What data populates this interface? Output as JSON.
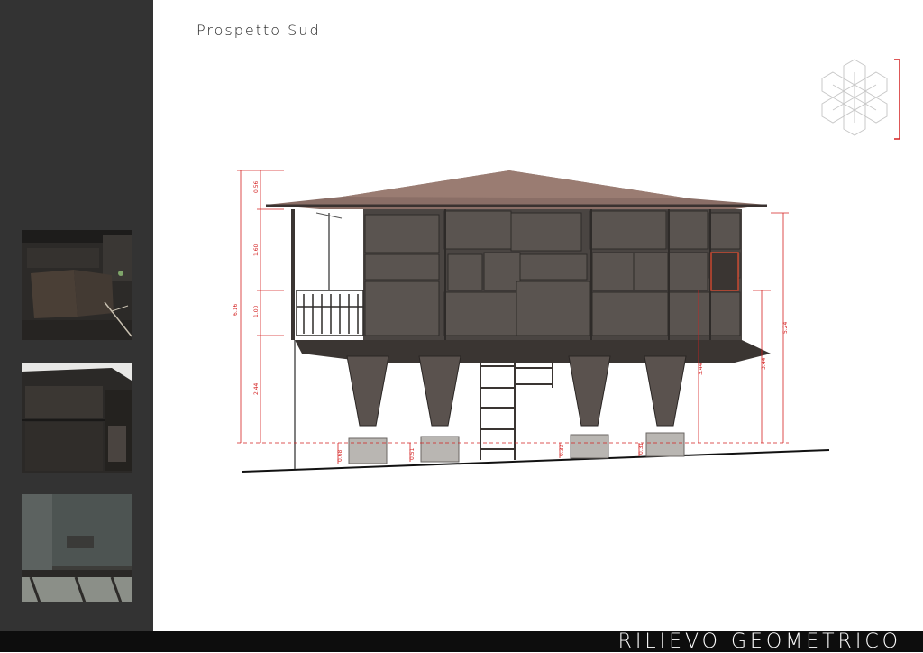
{
  "page": {
    "title": "Prospetto Sud",
    "footer_title": "RILIEVO GEOMETRICO"
  },
  "sidebar": {
    "photos": [
      {
        "name": "photo-detail-1"
      },
      {
        "name": "photo-detail-2"
      },
      {
        "name": "photo-detail-3"
      }
    ]
  },
  "dimensions": {
    "left_total": "6.16",
    "left_segments": [
      "0.56",
      "1.60",
      "1.00",
      "2.44"
    ],
    "right_total": "5.24",
    "right_mid": "3.44",
    "piers": [
      "0.68",
      "0.51",
      "0.33",
      "3.44",
      "0.31"
    ],
    "inner": [
      "3.44"
    ]
  },
  "colors": {
    "sidebar": "#333333",
    "footer": "#0d0d0d",
    "dimension_line": "#d42020",
    "facade": "#4a4542",
    "roof": "#8a6e66"
  }
}
